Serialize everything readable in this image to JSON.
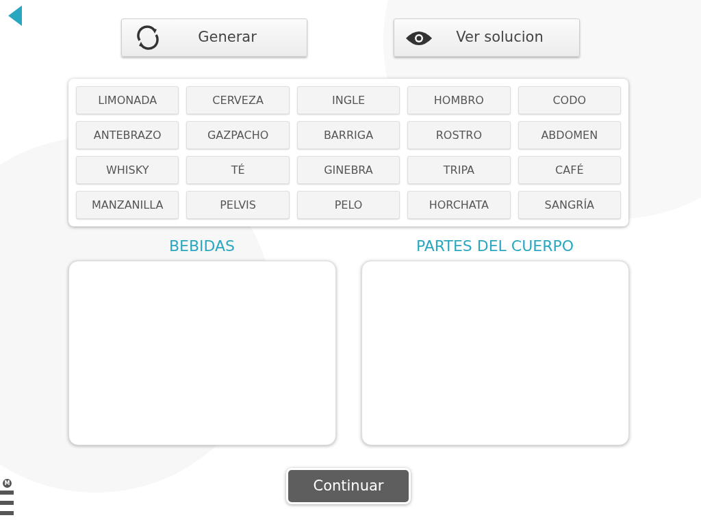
{
  "toolbar": {
    "buttons": [
      {
        "kind": "refresh",
        "label": "Generar"
      },
      {
        "kind": "eye",
        "label": "Ver solucion"
      }
    ]
  },
  "words": [
    "LIMONADA",
    "CERVEZA",
    "INGLE",
    "HOMBRO",
    "CODO",
    "ANTEBRAZO",
    "GAZPACHO",
    "BARRIGA",
    "ROSTRO",
    "ABDOMEN",
    "WHISKY",
    "TÉ",
    "GINEBRA",
    "TRIPA",
    "CAFÉ",
    "MANZANILLA",
    "PELVIS",
    "PELO",
    "HORCHATA",
    "SANGRÍA"
  ],
  "categories": [
    {
      "title": "BEBIDAS"
    },
    {
      "title": "PARTES DEL CUERPO"
    }
  ],
  "continue_button": "Continuar",
  "menu_badge": "M"
}
